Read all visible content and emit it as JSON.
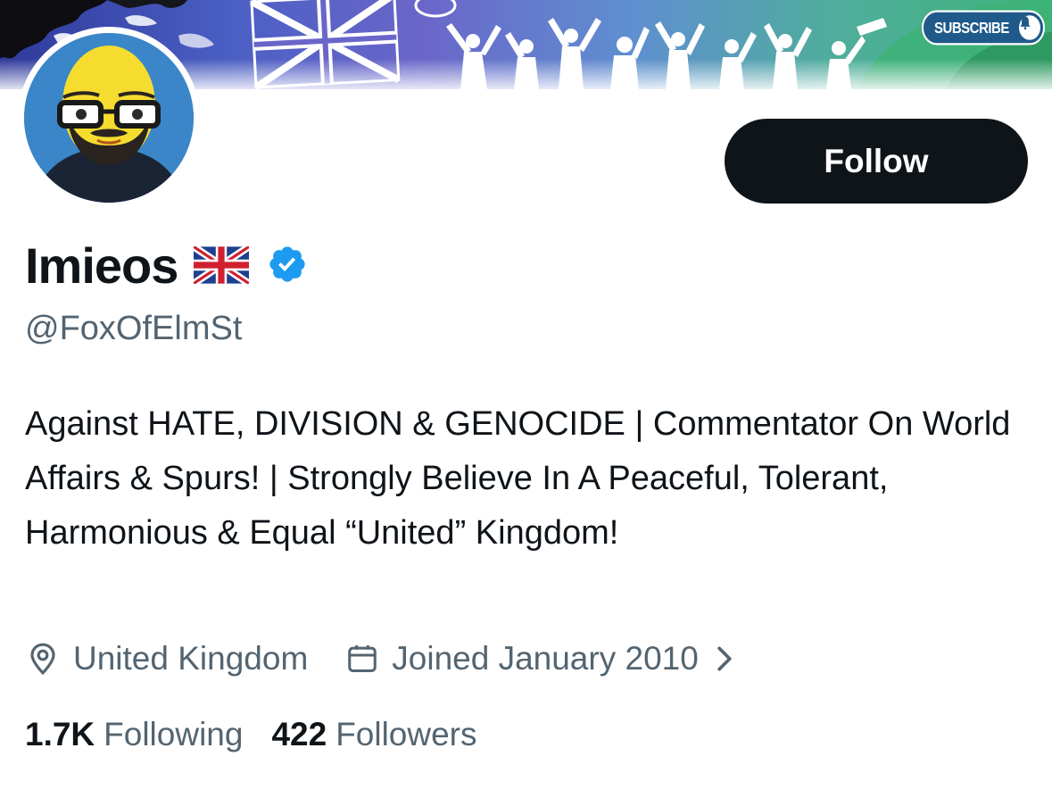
{
  "banner": {
    "subscribe_label": "SUBSCRIBE",
    "icons": [
      "world-map",
      "union-jack",
      "crowd-silhouettes",
      "bell-icon"
    ]
  },
  "avatar": {
    "description_icon": "cartoon-man-glasses-avatar"
  },
  "follow_button": {
    "label": "Follow"
  },
  "profile": {
    "display_name": "Imieos",
    "name_icons": [
      "uk-flag-icon",
      "verified-badge-icon"
    ],
    "handle": "@FoxOfElmSt",
    "bio": "Against HATE, DIVISION & GENOCIDE | Commentator On World Affairs & Spurs! | Strongly Believe In A Peaceful, Tolerant, Harmonious & Equal “United” Kingdom!",
    "location": "United Kingdom",
    "joined": "Joined January 2010"
  },
  "stats": {
    "following_count": "1.7K",
    "following_label": "Following",
    "followers_count": "422",
    "followers_label": "Followers"
  },
  "colors": {
    "text_primary": "#0f1419",
    "text_secondary": "#536471",
    "button_bg": "#0f1419",
    "verified_blue": "#1d9bf0"
  }
}
